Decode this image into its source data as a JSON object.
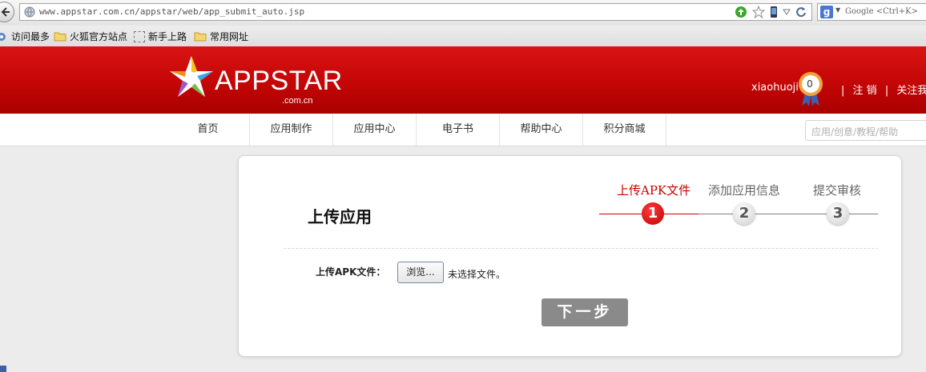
{
  "browser": {
    "url": "www.appstar.com.cn/appstar/web/app_submit_auto.jsp",
    "search_placeholder": "Google <Ctrl+K>",
    "bookmarks": [
      {
        "label": "访问最多",
        "icon": "gear-icon"
      },
      {
        "label": "火狐官方站点",
        "icon": "folder-icon"
      },
      {
        "label": "新手上路",
        "icon": "page-icon"
      },
      {
        "label": "常用网址",
        "icon": "folder-icon"
      }
    ]
  },
  "header": {
    "logo_text": "APPSTAR",
    "logo_sub": ".com.cn",
    "username": "xiaohuoji",
    "medal_count": "0",
    "logout_label": "注 销",
    "follow_label": "关注我们",
    "separator": "|",
    "brand_color": "#c80606"
  },
  "nav": {
    "items": [
      "首页",
      "应用制作",
      "应用中心",
      "电子书",
      "帮助中心",
      "积分商城"
    ],
    "search_placeholder": "应用/创意/教程/帮助"
  },
  "main": {
    "title": "上传应用",
    "steps": [
      {
        "number": "1",
        "label": "上传APK文件",
        "active": true
      },
      {
        "number": "2",
        "label": "添加应用信息",
        "active": false
      },
      {
        "number": "3",
        "label": "提交审核",
        "active": false
      }
    ],
    "field_label": "上传APK文件：",
    "browse_label": "浏览...",
    "no_file_text": "未选择文件。",
    "next_label": "下一步"
  }
}
